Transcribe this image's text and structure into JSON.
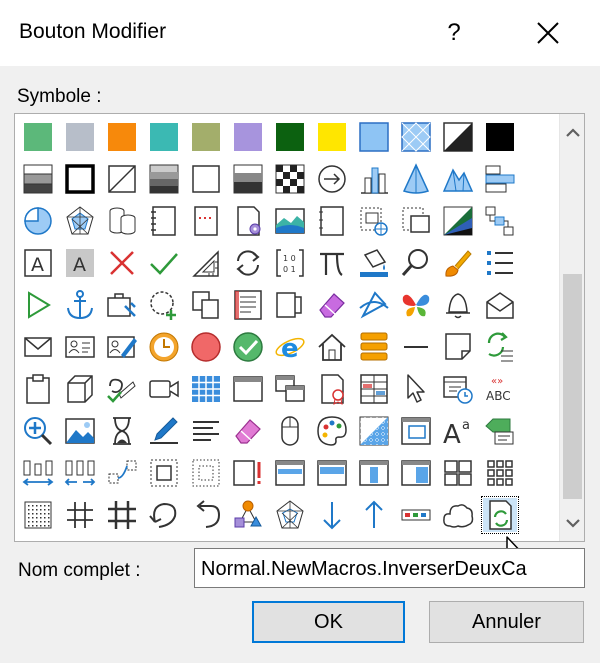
{
  "window": {
    "title": "Bouton Modifier",
    "help_label": "?"
  },
  "symbol_section": {
    "label": "Symbole :"
  },
  "icons": [
    [
      "green-swatch-icon",
      "gray-swatch-icon",
      "orange-swatch-icon",
      "teal-swatch-icon",
      "olive-swatch-icon",
      "purple-swatch-icon",
      "dark-green-swatch-icon",
      "yellow-swatch-icon",
      "blue-square-icon",
      "blue-pattern-icon",
      "diagonal-fill-icon",
      "black-square-icon"
    ],
    [
      "gradient-square-icon",
      "bold-border-square-icon",
      "diagonal-line-square-icon",
      "gray-gradient-square-icon",
      "white-square-icon",
      "dark-gradient-square-icon",
      "checker-pattern-icon",
      "circle-arrow-icon",
      "bar-chart-icon",
      "cone-icon",
      "mountain-icon",
      "text-align-left-icon"
    ],
    [
      "pie-chart-icon",
      "radar-chart-icon",
      "cylinder-chart-icon",
      "notebook-icon",
      "dotted-page-icon",
      "gear-page-icon",
      "image-landscape-icon",
      "document-frame-icon",
      "globe-page-icon",
      "dotted-select-icon",
      "triangle-color-icon",
      "flowchart-icon"
    ],
    [
      "text-box-icon",
      "shaded-text-icon",
      "red-cross-icon",
      "green-check-icon",
      "ruler-triangle-icon",
      "refresh-arrows-icon",
      "binary-bracket-icon",
      "pi-symbol-icon",
      "paint-bucket-icon",
      "magnifier-icon",
      "paint-brush-icon",
      "bullet-list-icon"
    ],
    [
      "play-arrow-icon",
      "anchor-icon",
      "toolbox-icon",
      "dashed-circle-icon",
      "stacked-pages-icon",
      "list-document-icon",
      "copy-page-icon",
      "eraser-icon",
      "pen-tool-icon",
      "butterfly-icon",
      "bell-icon",
      "open-envelope-icon"
    ],
    [
      "envelope-icon",
      "contact-card-icon",
      "edit-card-icon",
      "clock-icon",
      "red-circle-icon",
      "green-check-circle-icon",
      "internet-explorer-icon",
      "home-icon",
      "stacked-layers-icon",
      "horizontal-line-icon",
      "sticky-note-icon",
      "sync-list-icon"
    ],
    [
      "clipboard-icon",
      "cube-icon",
      "link-cursor-icon",
      "video-camera-icon",
      "table-grid-icon",
      "window-icon",
      "overlap-windows-icon",
      "certificate-icon",
      "grid-list-icon",
      "pointer-arrow-icon",
      "calendar-clock-icon",
      "spell-check-icon"
    ],
    [
      "zoom-in-icon",
      "picture-icon",
      "hourglass-icon",
      "signature-pen-icon",
      "align-text-icon",
      "pink-eraser-icon",
      "mouse-icon",
      "palette-icon",
      "gradient-grid-icon",
      "window-frame-icon",
      "text-size-icon",
      "green-tag-icon"
    ],
    [
      "distribute-horizontal-icon",
      "distribute-spread-icon",
      "dashed-connector-icon",
      "dashed-frame-icon",
      "dotted-frame-icon",
      "warning-page-icon",
      "split-top-icon",
      "split-panel-icon",
      "columns-icon",
      "split-window-icon",
      "tile-grid-icon",
      "dot-grid-icon"
    ],
    [
      "dotted-square-icon",
      "hash-icon",
      "grid-hash-icon",
      "undo-curve-icon",
      "back-curve-icon",
      "shapes-network-icon",
      "radar-web-icon",
      "down-arrow-icon",
      "up-arrow-icon",
      "color-dots-icon",
      "cloud-icon",
      "refresh-page-icon"
    ]
  ],
  "name_section": {
    "label": "Nom complet :",
    "value": "Normal.NewMacros.InverserDeuxCa"
  },
  "buttons": {
    "ok": "OK",
    "cancel": "Annuler"
  }
}
